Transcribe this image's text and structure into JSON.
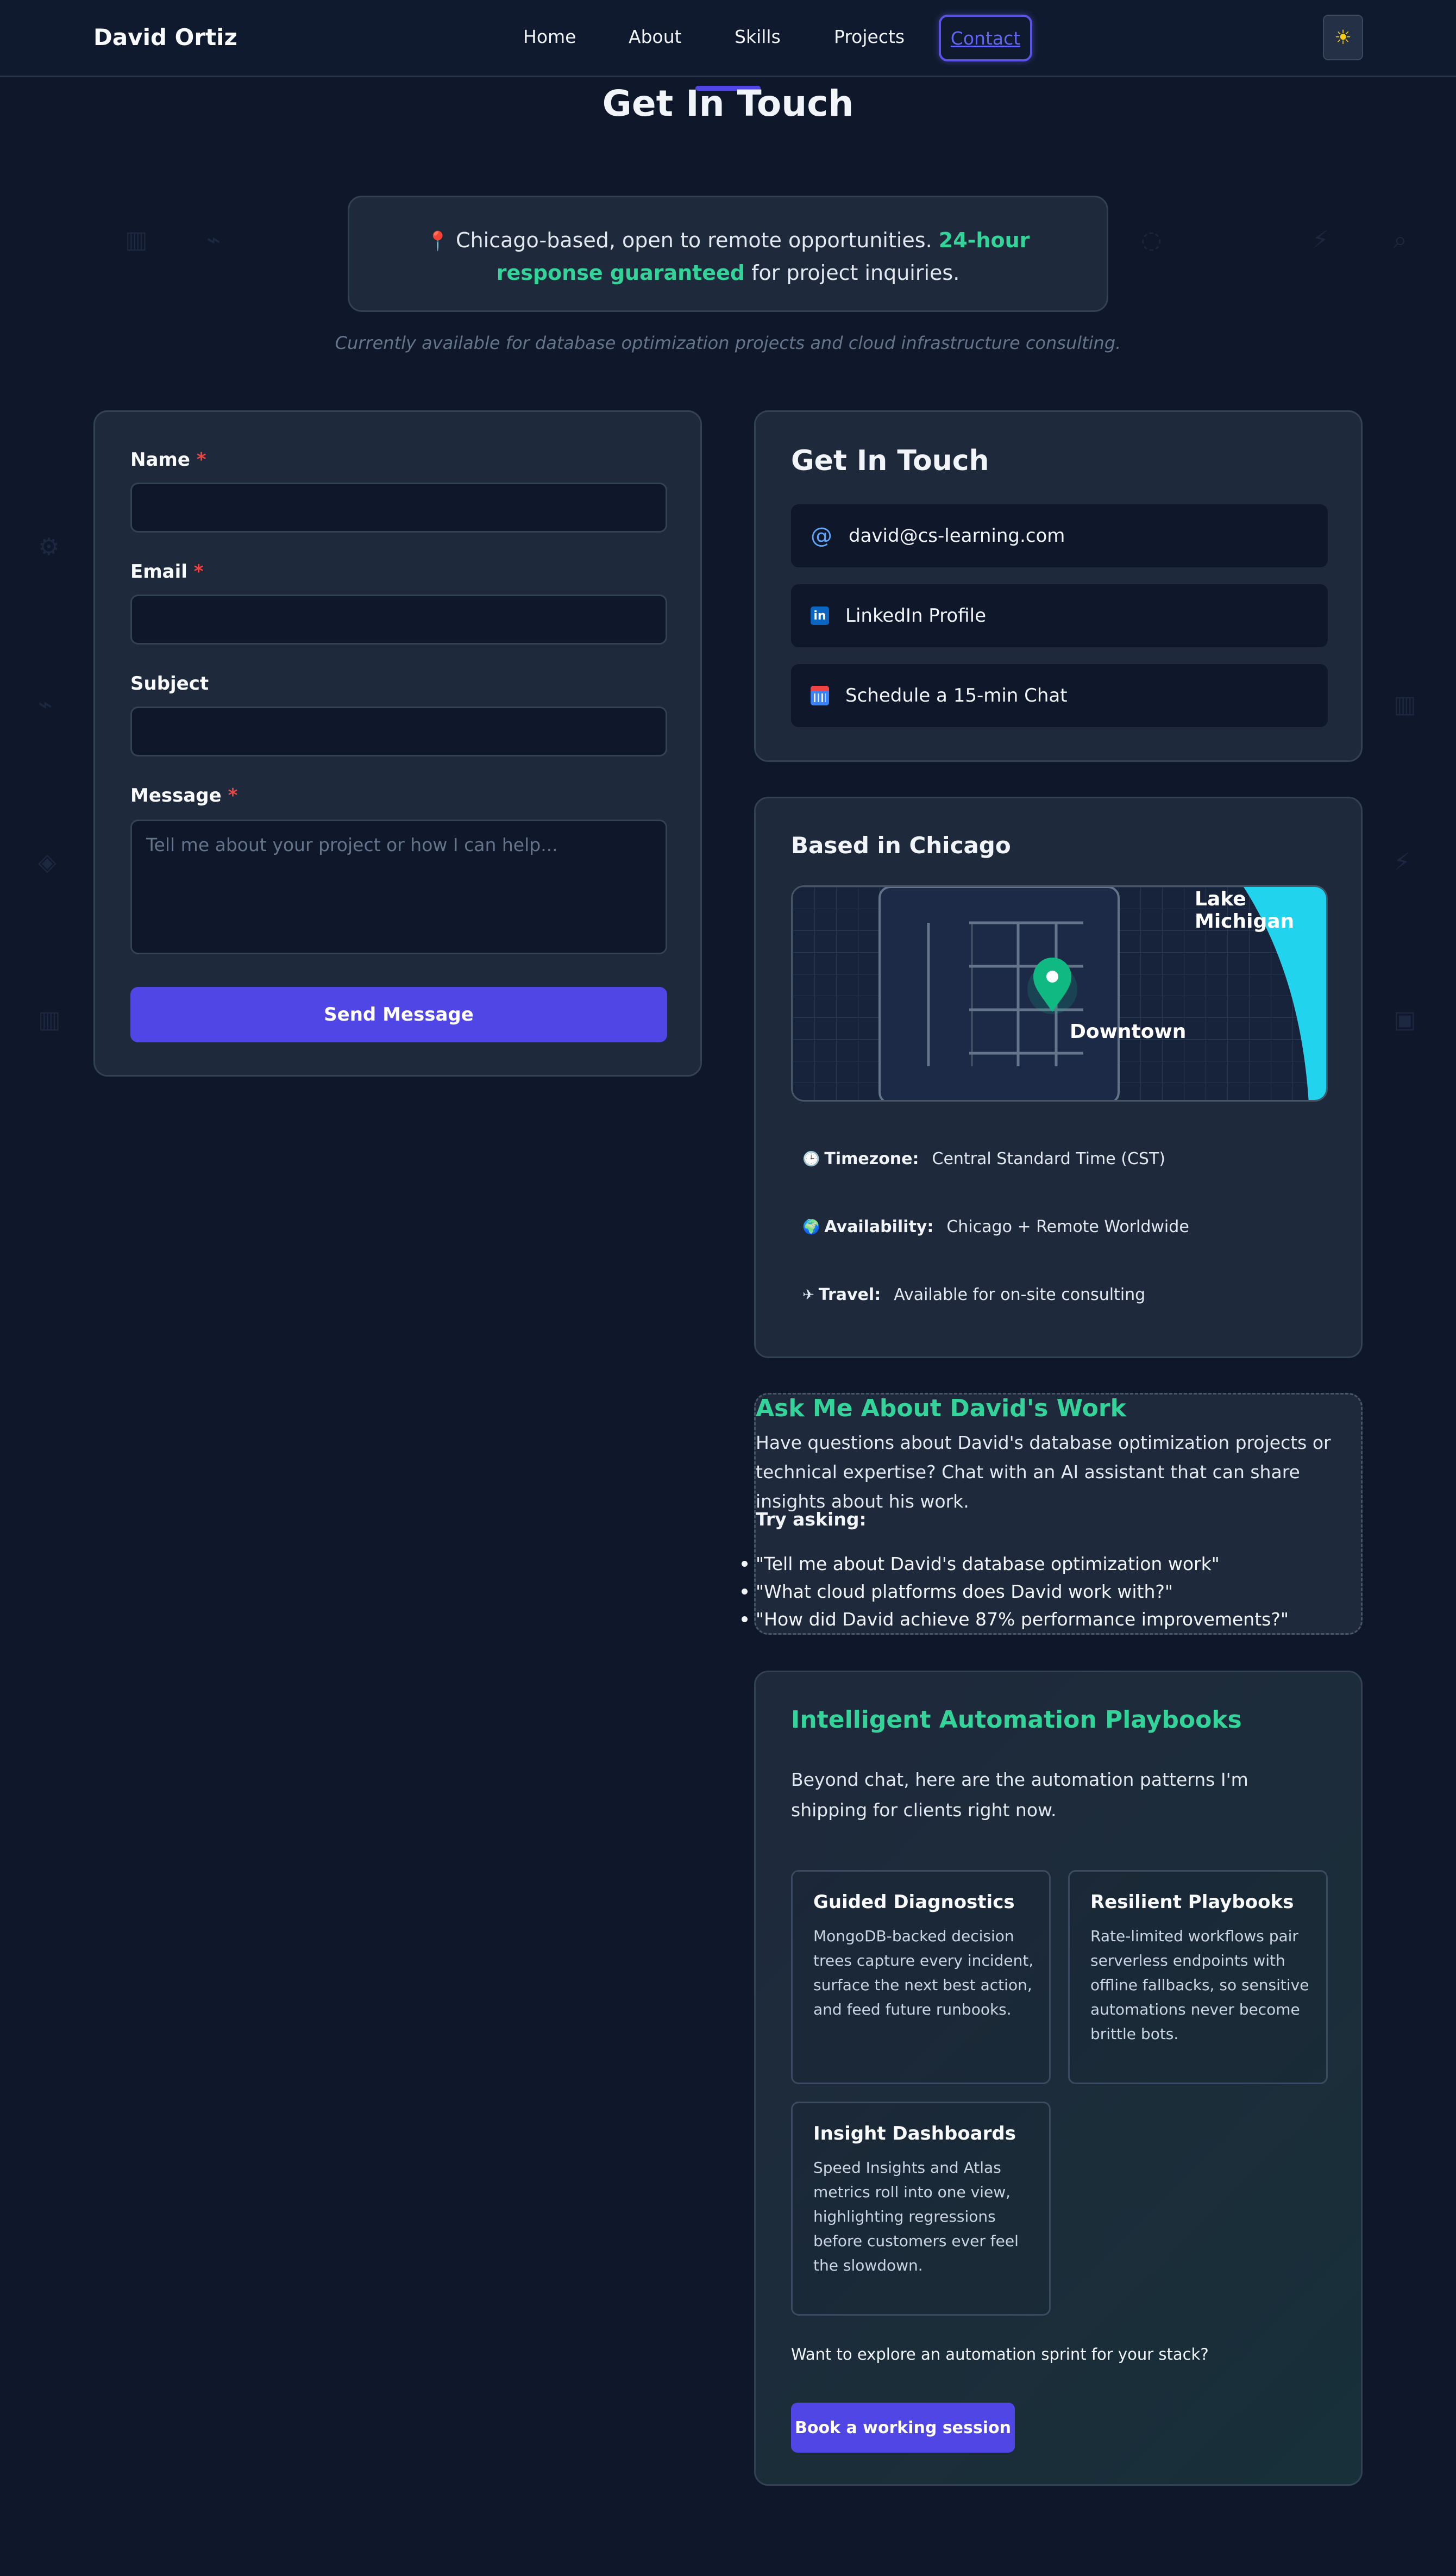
{
  "nav": {
    "brand": "David Ortiz",
    "links": [
      "Home",
      "About",
      "Skills",
      "Projects"
    ],
    "active": "Contact",
    "theme_icon": "sun-icon"
  },
  "header": {
    "title": "Get In Touch",
    "intro_start": "Chicago-based, open to remote opportunities.",
    "intro_highlight": "24-hour response guaranteed",
    "intro_end": "for project inquiries.",
    "availability": "Currently available for database optimization projects and cloud infrastructure consulting."
  },
  "form": {
    "name_label": "Name",
    "email_label": "Email",
    "subject_label": "Subject",
    "message_label": "Message",
    "required_mark": "*",
    "message_placeholder": "Tell me about your project or how I can help...",
    "submit_label": "Send Message"
  },
  "contact": {
    "title": "Get In Touch",
    "email": "david@cs-learning.com",
    "linkedin": "LinkedIn Profile",
    "linkedin_icon_text": "in",
    "schedule": "Schedule a 15-min Chat"
  },
  "location": {
    "title": "Based in Chicago",
    "map_lake_label": "Lake Michigan",
    "map_downtown_label": "Downtown",
    "timezone_label": "Timezone:",
    "timezone_value": "Central Standard Time (CST)",
    "availability_label": "Availability:",
    "availability_value": "Chicago + Remote Worldwide",
    "travel_label": "Travel:",
    "travel_value": "Available for on-site consulting"
  },
  "chat": {
    "title": "Ask Me About David's Work",
    "text": "Have questions about David's database optimization projects or technical expertise? Chat with an AI assistant that can share insights about his work.",
    "try_label": "Try asking:",
    "questions": [
      "\"Tell me about David's database optimization work\"",
      "\"What cloud platforms does David work with?\"",
      "\"How did David achieve 87% performance improvements?\""
    ]
  },
  "automation": {
    "title": "Intelligent Automation Playbooks",
    "text": "Beyond chat, here are the automation patterns I'm shipping for clients right now.",
    "tiles": [
      {
        "title": "Guided Diagnostics",
        "text": "MongoDB-backed decision trees capture every incident, surface the next best action, and feed future runbooks."
      },
      {
        "title": "Resilient Playbooks",
        "text": "Rate-limited workflows pair serverless endpoints with offline fallbacks, so sensitive automations never become brittle bots."
      },
      {
        "title": "Insight Dashboards",
        "text": "Speed Insights and Atlas metrics roll into one view, highlighting regressions before customers ever feel the slowdown."
      }
    ],
    "question": "Want to explore an automation sprint for your stack?",
    "cta": "Book a working session"
  },
  "colors": {
    "background": "#0f172a",
    "card": "#1e293b",
    "accent": "#4f46e5",
    "green": "#34d399",
    "required": "#ef4444"
  }
}
